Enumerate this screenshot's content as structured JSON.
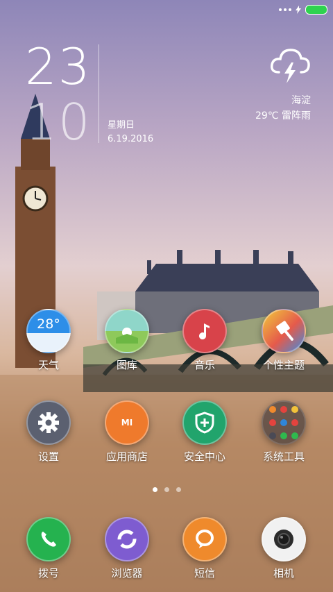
{
  "status_bar": {
    "signal": "signal-dots-icon",
    "charging": "charging-icon",
    "battery_color": "#2fd24f"
  },
  "clock": {
    "hours": "23",
    "minutes": "10",
    "weekday": "星期日",
    "date": "6.19.2016"
  },
  "weather": {
    "icon": "thunderstorm-cloud-icon",
    "city": "海淀",
    "temp_desc": "29℃  雷阵雨"
  },
  "apps": [
    {
      "label": "天气",
      "icon": "weather-icon",
      "badge": "28°"
    },
    {
      "label": "图库",
      "icon": "gallery-icon"
    },
    {
      "label": "音乐",
      "icon": "music-icon"
    },
    {
      "label": "个性主题",
      "icon": "theme-brush-icon"
    },
    {
      "label": "设置",
      "icon": "settings-gear-icon"
    },
    {
      "label": "应用商店",
      "icon": "app-store-icon",
      "badge": "MI"
    },
    {
      "label": "安全中心",
      "icon": "security-shield-icon"
    },
    {
      "label": "系统工具",
      "icon": "system-tools-folder-icon"
    }
  ],
  "page_indicator": {
    "pages": 3,
    "current": 1
  },
  "dock": [
    {
      "label": "拨号",
      "icon": "phone-icon"
    },
    {
      "label": "浏览器",
      "icon": "browser-icon"
    },
    {
      "label": "短信",
      "icon": "message-icon"
    },
    {
      "label": "相机",
      "icon": "camera-icon"
    }
  ],
  "colors": {
    "music": "#d8434a",
    "appstore": "#ef7a2c",
    "security": "#21a46c",
    "phone": "#25b24f",
    "browser": "#7e5cd0",
    "sms": "#ef8a2c",
    "settings": "#5b6070"
  }
}
